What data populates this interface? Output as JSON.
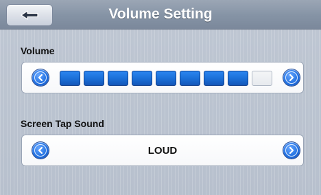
{
  "header": {
    "title": "Volume Setting",
    "back_icon": "arrow-left-icon"
  },
  "volume": {
    "label": "Volume",
    "level": 8,
    "max": 9,
    "left_icon": "chevron-left-icon",
    "right_icon": "chevron-right-icon",
    "active_color": "#1a6ed6",
    "inactive_color": "#e7eaee"
  },
  "tap_sound": {
    "label": "Screen Tap Sound",
    "value": "LOUD",
    "left_icon": "chevron-left-icon",
    "right_icon": "chevron-right-icon"
  },
  "colors": {
    "accent": "#1f6fe0",
    "header": "#8593a5",
    "background": "#bfc7d3"
  }
}
